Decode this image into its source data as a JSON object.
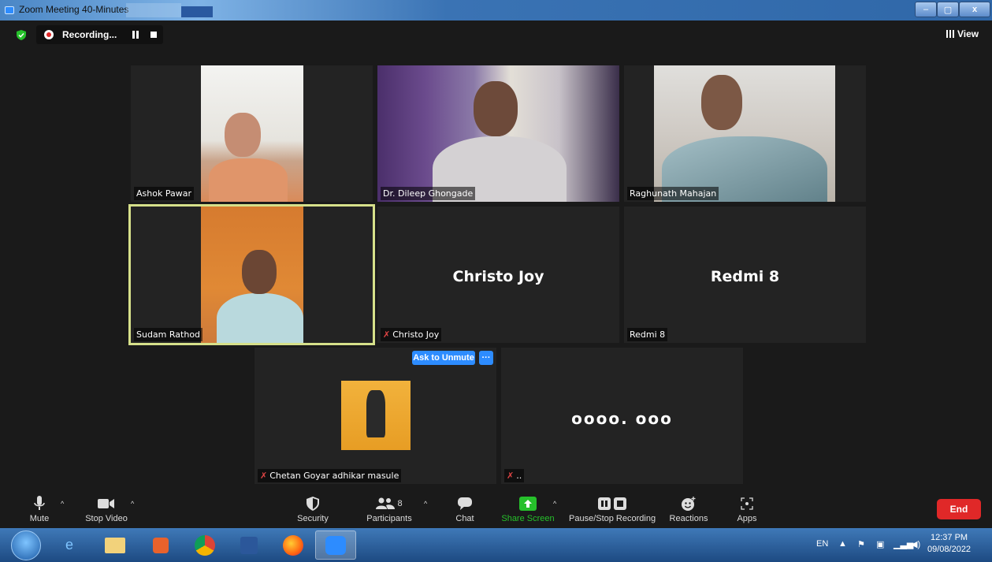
{
  "window": {
    "title": "Zoom Meeting 40-Minutes",
    "min": "–",
    "max": "▢",
    "close": "x"
  },
  "topbar": {
    "recording": "Recording...",
    "view": "View"
  },
  "tiles": {
    "ashok": "Ashok Pawar",
    "dileep": "Dr. Dileep Ghongade",
    "raghunath": "Raghunath Mahajan",
    "sudam": "Sudam Rathod",
    "christo_label": "Christo Joy",
    "christo_name": "Christo Joy",
    "redmi_label": "Redmi 8",
    "redmi_name": "Redmi 8",
    "chetan_label": "Chetan Goyar adhikar masule",
    "unknown_label": "..",
    "unknown_name": "ᴏᴏᴏᴏ. ᴏᴏᴏ"
  },
  "ask_unmute": "Ask to Unmute",
  "more_dots": "···",
  "toolbar": {
    "mute": "Mute",
    "stop_video": "Stop Video",
    "security": "Security",
    "participants": "Participants",
    "participants_count": "8",
    "chat": "Chat",
    "share": "Share Screen",
    "record": "Pause/Stop Recording",
    "reactions": "Reactions",
    "apps": "Apps",
    "end": "End"
  },
  "taskbar": {
    "lang": "EN",
    "time": "12:37 PM",
    "date": "09/08/2022"
  },
  "colors": {
    "accent": "#2d8cff",
    "end": "#e02828",
    "share": "#26c02b",
    "active_border": "#d6e08a"
  }
}
